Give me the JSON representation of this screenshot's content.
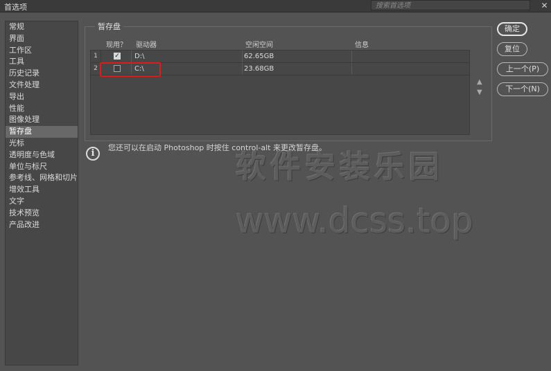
{
  "window": {
    "title": "首选项"
  },
  "search": {
    "placeholder": "搜索首选项"
  },
  "sidebar": {
    "items": [
      {
        "label": "常规"
      },
      {
        "label": "界面"
      },
      {
        "label": "工作区"
      },
      {
        "label": "工具"
      },
      {
        "label": "历史记录"
      },
      {
        "label": "文件处理"
      },
      {
        "label": "导出"
      },
      {
        "label": "性能"
      },
      {
        "label": "图像处理"
      },
      {
        "label": "暂存盘"
      },
      {
        "label": "光标"
      },
      {
        "label": "透明度与色域"
      },
      {
        "label": "单位与标尺"
      },
      {
        "label": "参考线、网格和切片"
      },
      {
        "label": "增效工具"
      },
      {
        "label": "文字"
      },
      {
        "label": "技术预览"
      },
      {
        "label": "产品改进"
      }
    ],
    "active": "暂存盘"
  },
  "scratch": {
    "group_title": "暂存盘",
    "headers": {
      "active": "现用？",
      "drive": "驱动器",
      "free": "空闲空间",
      "info": "信息"
    },
    "rows": [
      {
        "num": "1",
        "checked": true,
        "drive": "D:\\",
        "free": "62.65GB",
        "info": ""
      },
      {
        "num": "2",
        "checked": false,
        "drive": "C:\\",
        "free": "23.68GB",
        "info": ""
      }
    ]
  },
  "info": {
    "text": "您还可以在启动 Photoshop 时按住 control-alt 来更改暂存盘。"
  },
  "buttons": {
    "ok": "确定",
    "reset": "复位",
    "prev": "上一个(P)",
    "next": "下一个(N)"
  },
  "watermark": {
    "line1": "软件安装乐园",
    "line2": "www.dcss.top"
  },
  "icons": {
    "close": "close-icon",
    "info": "info-icon",
    "up": "up-arrow-icon",
    "down": "down-arrow-icon",
    "check": "checkmark-icon"
  },
  "colors": {
    "background": "#535353",
    "highlight": "#e01b1b"
  }
}
